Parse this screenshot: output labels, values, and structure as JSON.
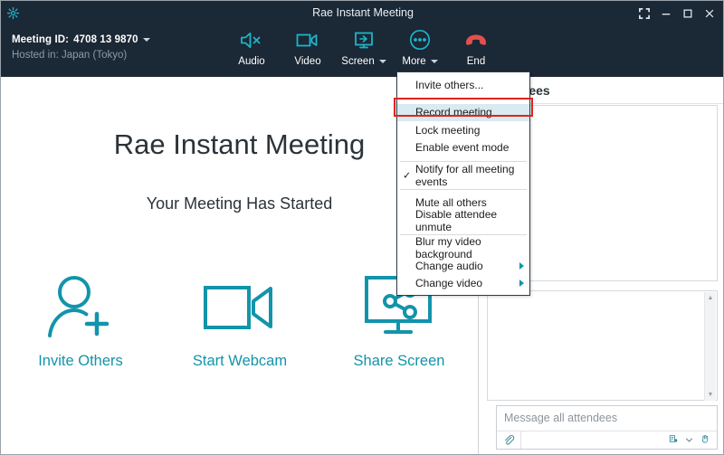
{
  "window": {
    "title": "Rae Instant Meeting",
    "logo_icon": "gear-logo-icon",
    "controls": [
      {
        "name": "fullscreen-button",
        "icon": "fullscreen-icon"
      },
      {
        "name": "minimize-button",
        "icon": "minimize-icon"
      },
      {
        "name": "maximize-button",
        "icon": "maximize-icon"
      },
      {
        "name": "close-button",
        "icon": "close-icon"
      }
    ]
  },
  "toolbar": {
    "meeting_id_label": "Meeting ID:",
    "meeting_id_value": "4708 13 9870",
    "hosted_in": "Hosted in: Japan (Tokyo)",
    "buttons": [
      {
        "label": "Audio",
        "icon": "speaker-muted-icon",
        "has_caret": false
      },
      {
        "label": "Video",
        "icon": "video-camera-icon",
        "has_caret": false
      },
      {
        "label": "Screen",
        "icon": "share-screen-icon",
        "has_caret": true
      },
      {
        "label": "More",
        "icon": "more-dots-icon",
        "has_caret": true
      },
      {
        "label": "End",
        "icon": "end-call-icon",
        "has_caret": false
      }
    ]
  },
  "menu": {
    "items": [
      {
        "label": "Invite others...",
        "checked": false,
        "highlight": false,
        "submenu": false
      },
      {
        "separator": true
      },
      {
        "label": "Record meeting",
        "checked": false,
        "highlight": true,
        "submenu": false
      },
      {
        "label": "Lock meeting",
        "checked": false,
        "highlight": false,
        "submenu": false
      },
      {
        "label": "Enable event mode",
        "checked": false,
        "highlight": false,
        "submenu": false
      },
      {
        "separator": true
      },
      {
        "label": "Notify for all meeting events",
        "checked": true,
        "highlight": false,
        "submenu": false
      },
      {
        "separator": true
      },
      {
        "label": "Mute all others",
        "checked": false,
        "highlight": false,
        "submenu": false
      },
      {
        "label": "Disable attendee unmute",
        "checked": false,
        "highlight": false,
        "submenu": false
      },
      {
        "separator": true
      },
      {
        "label": "Blur my video background",
        "checked": false,
        "highlight": false,
        "submenu": false
      },
      {
        "label": "Change audio",
        "checked": false,
        "highlight": false,
        "submenu": true
      },
      {
        "label": "Change video",
        "checked": false,
        "highlight": false,
        "submenu": true
      }
    ]
  },
  "stage": {
    "title": "Rae Instant Meeting",
    "subtitle": "Your Meeting Has Started",
    "actions": [
      {
        "label": "Invite Others",
        "icon": "add-person-icon"
      },
      {
        "label": "Start Webcam",
        "icon": "video-camera-icon"
      },
      {
        "label": "Share Screen",
        "icon": "share-screen-monitor-icon"
      }
    ]
  },
  "right_panel": {
    "attendees_header": "Attendees",
    "chat_placeholder": "Message all attendees",
    "chat_tools": [
      {
        "name": "attach-file-icon"
      },
      {
        "name": "send-to-icon"
      },
      {
        "name": "chevron-down-icon"
      },
      {
        "name": "emoji-hand-icon"
      }
    ]
  },
  "colors": {
    "header_bg": "#1b2835",
    "accent_teal": "#1294ab",
    "end_red": "#e2504b",
    "highlight_outline": "#e2231a",
    "menu_highlight": "#d9eaf0"
  }
}
